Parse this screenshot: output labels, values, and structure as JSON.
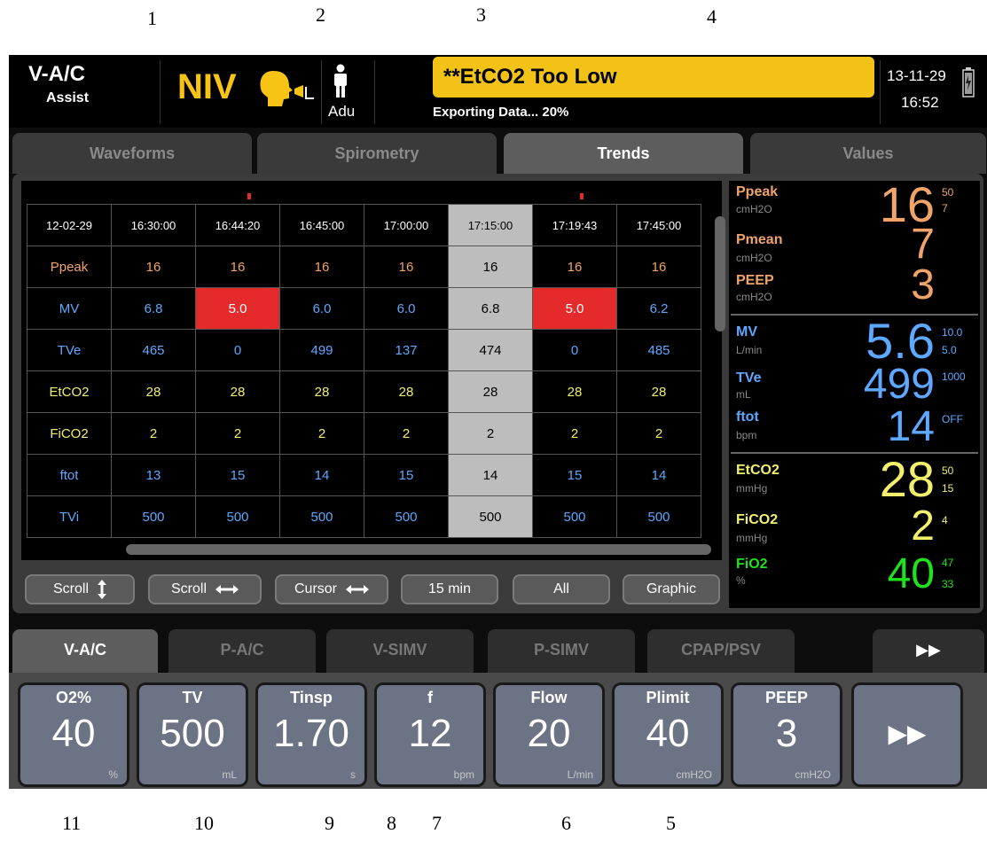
{
  "callouts": {
    "c1": "1",
    "c2": "2",
    "c3": "3",
    "c4": "4",
    "c5": "5",
    "c6": "6",
    "c7": "7",
    "c8": "8",
    "c9": "9",
    "c10": "10",
    "c11": "11"
  },
  "header": {
    "mode": "V-A/C",
    "submode": "Assist",
    "niv": "NIV",
    "patient": "Adu",
    "alarm": "**EtCO2 Too Low",
    "export": "Exporting Data... 20%",
    "date": "13-11-29",
    "time": "16:52"
  },
  "tabs": [
    "Waveforms",
    "Spirometry",
    "Trends",
    "Values"
  ],
  "trend": {
    "header": [
      "12-02-29",
      "16:30:00",
      "16:44:20",
      "16:45:00",
      "17:00:00",
      "17:15:00",
      "17:19:43",
      "17:45:00"
    ],
    "rows": [
      {
        "label": "Ppeak",
        "color": "#f0a46a",
        "values": [
          "16",
          "16",
          "16",
          "16",
          "16",
          "16",
          "16"
        ]
      },
      {
        "label": "MV",
        "color": "#5fa8ff",
        "values": [
          "6.8",
          "5.0",
          "6.0",
          "6.0",
          "6.8",
          "5.0",
          "6.2"
        ]
      },
      {
        "label": "TVe",
        "color": "#5fa8ff",
        "values": [
          "465",
          "0",
          "499",
          "137",
          "474",
          "0",
          "485"
        ]
      },
      {
        "label": "EtCO2",
        "color": "#f2ef6c",
        "values": [
          "28",
          "28",
          "28",
          "28",
          "28",
          "28",
          "28"
        ]
      },
      {
        "label": "FiCO2",
        "color": "#f2ef6c",
        "values": [
          "2",
          "2",
          "2",
          "2",
          "2",
          "2",
          "2"
        ]
      },
      {
        "label": "ftot",
        "color": "#5fa8ff",
        "values": [
          "13",
          "15",
          "14",
          "15",
          "14",
          "15",
          "14"
        ]
      },
      {
        "label": "TVi",
        "color": "#5fa8ff",
        "values": [
          "500",
          "500",
          "500",
          "500",
          "500",
          "500",
          "500"
        ]
      }
    ]
  },
  "buttons": {
    "scroll_v": "Scroll",
    "scroll_h": "Scroll",
    "cursor": "Cursor",
    "interval": "15 min",
    "filter": "All",
    "view": "Graphic"
  },
  "values": {
    "ppeak": {
      "name": "Ppeak",
      "unit": "cmH2O",
      "value": "16",
      "hi": "50",
      "lo": "7"
    },
    "pmean": {
      "name": "Pmean",
      "unit": "cmH2O",
      "value": "7"
    },
    "peep": {
      "name": "PEEP",
      "unit": "cmH2O",
      "value": "3"
    },
    "mv": {
      "name": "MV",
      "unit": "L/min",
      "value": "5.6",
      "hi": "10.0",
      "lo": "5.0"
    },
    "tve": {
      "name": "TVe",
      "unit": "mL",
      "value": "499",
      "hi": "1000"
    },
    "ftot": {
      "name": "ftot",
      "unit": "bpm",
      "value": "14",
      "hi": "OFF"
    },
    "etco2": {
      "name": "EtCO2",
      "unit": "mmHg",
      "value": "28",
      "hi": "50",
      "lo": "15"
    },
    "fico2": {
      "name": "FiCO2",
      "unit": "mmHg",
      "value": "2",
      "hi": "4"
    },
    "fio2": {
      "name": "FiO2",
      "unit": "%",
      "value": "40",
      "hi": "47",
      "lo": "33"
    }
  },
  "modes": [
    "V-A/C",
    "P-A/C",
    "V-SIMV",
    "P-SIMV",
    "CPAP/PSV",
    "▶▶"
  ],
  "params": [
    {
      "name": "O2%",
      "value": "40",
      "unit": "%"
    },
    {
      "name": "TV",
      "value": "500",
      "unit": "mL"
    },
    {
      "name": "Tinsp",
      "value": "1.70",
      "unit": "s"
    },
    {
      "name": "f",
      "value": "12",
      "unit": "bpm"
    },
    {
      "name": "Flow",
      "value": "20",
      "unit": "L/min"
    },
    {
      "name": "Plimit",
      "value": "40",
      "unit": "cmH2O"
    },
    {
      "name": "PEEP",
      "value": "3",
      "unit": "cmH2O"
    }
  ],
  "more": "▶▶",
  "colors": {
    "alarm": "#f2c316",
    "niv": "#f7c315",
    "pressure": "#f0a46a",
    "volume": "#5fa8ff",
    "co2": "#f2ef6c",
    "o2": "#1fe21f",
    "highlight": "#e42a2a"
  }
}
